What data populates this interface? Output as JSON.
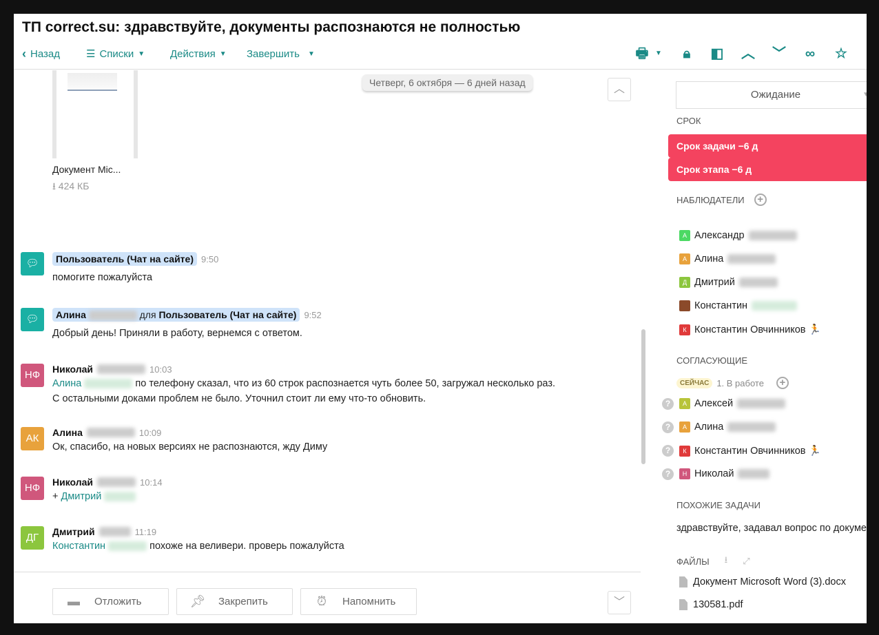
{
  "header": {
    "title": "ТП correct.su: здравствуйте, документы распознаются не полностью",
    "back": "Назад",
    "lists": "Списки",
    "actions": "Действия",
    "finish": "Завершить"
  },
  "attachment": {
    "name": "Документ Mic...",
    "size": "424 КБ"
  },
  "date_divider": "Четверг, 6 октября — 6 дней назад",
  "messages": [
    {
      "initials": "",
      "author": "Пользователь (Чат на сайте)",
      "time": "9:50",
      "text": "помогите пожалуйста",
      "color": "#1ab0a4"
    },
    {
      "initials": "",
      "author": "Алина",
      "for": "для",
      "recipient": "Пользователь (Чат на сайте)",
      "time": "9:52",
      "text": "Добрый день! Приняли в работу, вернемся с ответом.",
      "color": "#1ab0a4"
    },
    {
      "initials": "НФ",
      "author": "Николай",
      "time": "10:03",
      "mention": "Алина",
      "text": "по телефону сказал, что из 60 строк распознается чуть более 50, загружал несколько раз.",
      "text2": "С остальными доками проблем не было. Уточнил стоит ли ему что-то обновить.",
      "color": "#d0577c"
    },
    {
      "initials": "АК",
      "author": "Алина",
      "time": "10:09",
      "text": "Ок, спасибо, на новых версиях не распознаются, жду Диму",
      "color": "#e8a23c"
    },
    {
      "initials": "НФ",
      "author": "Николай",
      "time": "10:14",
      "prefix": "+",
      "mention": "Дмитрий",
      "color": "#d0577c"
    },
    {
      "initials": "ДГ",
      "author": "Дмитрий",
      "time": "11:19",
      "mention": "Константин",
      "text": "похоже на веливери. проверь пожалуйста",
      "color": "#8cc63e"
    }
  ],
  "actions": {
    "postpone": "Отложить",
    "pin": "Закрепить",
    "remind": "Напомнить"
  },
  "sidebar": {
    "status": "Ожидание",
    "deadline_label": "СРОК",
    "task_due": "Срок задачи −6 д",
    "stage_due": "Срок этапа −6 д",
    "watchers_label": "НАБЛЮДАТЕЛИ",
    "watchers": [
      {
        "initial": "А",
        "name": "Александр",
        "color": "#4cd964"
      },
      {
        "initial": "А",
        "name": "Алина",
        "color": "#e8a23c"
      },
      {
        "initial": "Д",
        "name": "Дмитрий",
        "color": "#8cc63e"
      },
      {
        "initial": "",
        "name": "Константин",
        "color": "#8b4a2a"
      },
      {
        "initial": "К",
        "name": "Константин Овчинников 🏃",
        "color": "#e03a3a"
      }
    ],
    "approvers_label": "СОГЛАСУЮЩИЕ",
    "now_badge": "СЕЙЧАС",
    "stage": "1. В работе",
    "approvers": [
      {
        "initial": "А",
        "name": "Алексей",
        "color": "#b8c43a"
      },
      {
        "initial": "А",
        "name": "Алина",
        "color": "#e8a23c"
      },
      {
        "initial": "К",
        "name": "Константин Овчинников 🏃",
        "color": "#e03a3a"
      },
      {
        "initial": "Н",
        "name": "Николай",
        "color": "#d0577c"
      }
    ],
    "similar_label": "ПОХОЖИЕ ЗАДАЧИ",
    "similar": "здравствуйте, задавал вопрос по документам",
    "files_label": "ФАЙЛЫ",
    "files": [
      "Документ Microsoft Word (3).docx",
      "130581.pdf"
    ]
  }
}
